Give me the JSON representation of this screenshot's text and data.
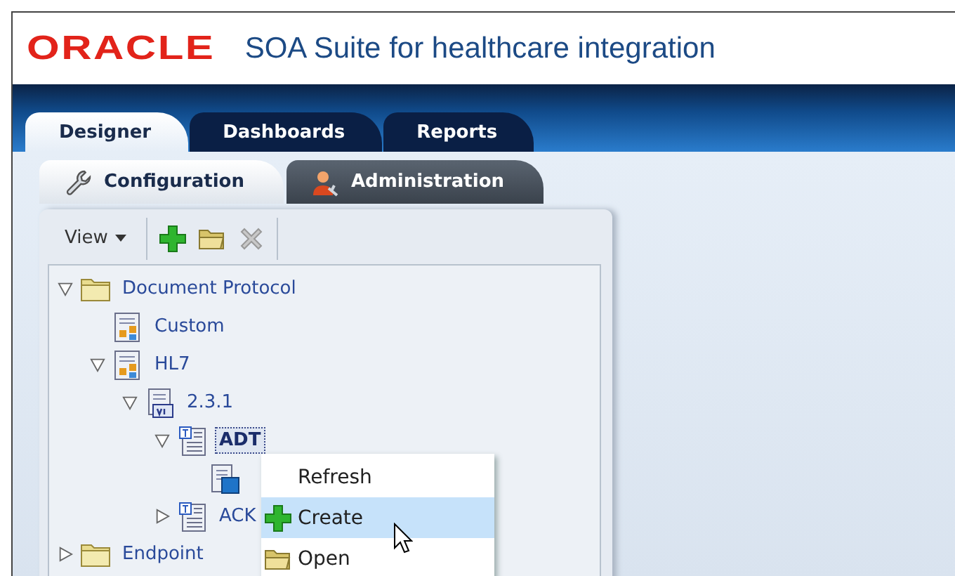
{
  "header": {
    "logo": "ORACLE",
    "title": "SOA Suite for healthcare integration"
  },
  "tabs": [
    {
      "label": "Designer",
      "selected": true
    },
    {
      "label": "Dashboards",
      "selected": false
    },
    {
      "label": "Reports",
      "selected": false
    }
  ],
  "subtabs": [
    {
      "label": "Configuration",
      "selected": true
    },
    {
      "label": "Administration",
      "selected": false
    }
  ],
  "toolbar": {
    "view": "View"
  },
  "tree": [
    {
      "label": "Document Protocol",
      "kind": "folder",
      "expanded": true,
      "selected": false,
      "children": [
        {
          "label": "Custom",
          "kind": "doctype",
          "selected": false
        },
        {
          "label": "HL7",
          "kind": "doctype",
          "expanded": true,
          "selected": false,
          "children": [
            {
              "label": "2.3.1",
              "kind": "version",
              "expanded": true,
              "selected": false,
              "children": [
                {
                  "label": "ADT",
                  "kind": "transaction",
                  "expanded": true,
                  "selected": true,
                  "children": [
                    {
                      "kind": "definition"
                    }
                  ]
                },
                {
                  "label": "ACK",
                  "kind": "transaction",
                  "expanded": false,
                  "selected": false
                }
              ]
            }
          ]
        }
      ]
    },
    {
      "label": "Endpoint",
      "kind": "folder",
      "expanded": false,
      "selected": false
    }
  ],
  "context_menu": [
    {
      "label": "Refresh",
      "selected": false
    },
    {
      "label": "Create",
      "selected": true
    },
    {
      "label": "Open",
      "selected": false
    }
  ]
}
